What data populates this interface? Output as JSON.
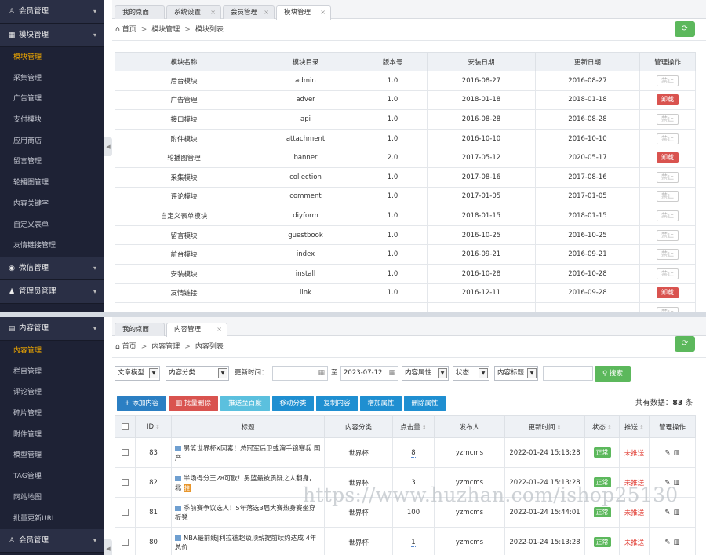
{
  "top": {
    "sidebar": {
      "groups_top": [
        {
          "icon": "user-icon",
          "glyph": "♙",
          "label": "会员管理"
        },
        {
          "icon": "module-icon",
          "glyph": "▦",
          "label": "模块管理"
        }
      ],
      "items": [
        "模块管理",
        "采集管理",
        "广告管理",
        "支付模块",
        "应用商店",
        "留言管理",
        "轮播图管理",
        "内容关键字",
        "自定义表单",
        "友情链接管理"
      ],
      "active_index": 0,
      "groups_bottom": [
        {
          "icon": "wechat-icon",
          "glyph": "◉",
          "label": "微信管理"
        },
        {
          "icon": "admin-user-icon",
          "glyph": "♟",
          "label": "管理员管理"
        }
      ]
    },
    "tabs": [
      "我的桌面",
      "系统设置",
      "会员管理",
      "模块管理"
    ],
    "active_tab": 3,
    "breadcrumb": [
      "首页",
      "模块管理",
      "模块列表"
    ],
    "table": {
      "headers": [
        "模块名称",
        "模块目录",
        "版本号",
        "安装日期",
        "更新日期",
        "管理操作"
      ],
      "disable_label": "禁止",
      "uninstall_label": "卸载",
      "rows": [
        {
          "name": "后台模块",
          "dir": "admin",
          "version": "1.0",
          "install": "2016-08-27",
          "update": "2016-08-27",
          "action": "disable"
        },
        {
          "name": "广告管理",
          "dir": "adver",
          "version": "1.0",
          "install": "2018-01-18",
          "update": "2018-01-18",
          "action": "uninstall"
        },
        {
          "name": "接口模块",
          "dir": "api",
          "version": "1.0",
          "install": "2016-08-28",
          "update": "2016-08-28",
          "action": "disable"
        },
        {
          "name": "附件模块",
          "dir": "attachment",
          "version": "1.0",
          "install": "2016-10-10",
          "update": "2016-10-10",
          "action": "disable"
        },
        {
          "name": "轮播图管理",
          "dir": "banner",
          "version": "2.0",
          "install": "2017-05-12",
          "update": "2020-05-17",
          "action": "uninstall"
        },
        {
          "name": "采集模块",
          "dir": "collection",
          "version": "1.0",
          "install": "2017-08-16",
          "update": "2017-08-16",
          "action": "disable"
        },
        {
          "name": "评论模块",
          "dir": "comment",
          "version": "1.0",
          "install": "2017-01-05",
          "update": "2017-01-05",
          "action": "disable"
        },
        {
          "name": "自定义表单模块",
          "dir": "diyform",
          "version": "1.0",
          "install": "2018-01-15",
          "update": "2018-01-15",
          "action": "disable"
        },
        {
          "name": "留言模块",
          "dir": "guestbook",
          "version": "1.0",
          "install": "2016-10-25",
          "update": "2016-10-25",
          "action": "disable"
        },
        {
          "name": "前台模块",
          "dir": "index",
          "version": "1.0",
          "install": "2016-09-21",
          "update": "2016-09-21",
          "action": "disable"
        },
        {
          "name": "安装模块",
          "dir": "install",
          "version": "1.0",
          "install": "2016-10-28",
          "update": "2016-10-28",
          "action": "disable"
        },
        {
          "name": "友情链接",
          "dir": "link",
          "version": "1.0",
          "install": "2016-12-11",
          "update": "2016-09-28",
          "action": "uninstall"
        },
        {
          "name": "",
          "dir": "",
          "version": "",
          "install": "",
          "update": "",
          "action": "disable"
        }
      ]
    }
  },
  "bottom": {
    "sidebar": {
      "groups_top": [
        {
          "icon": "content-icon",
          "glyph": "▤",
          "label": "内容管理"
        }
      ],
      "items": [
        "内容管理",
        "栏目管理",
        "评论管理",
        "碎片管理",
        "附件管理",
        "模型管理",
        "TAG管理",
        "网站地图",
        "批量更新URL"
      ],
      "active_index": 0,
      "groups_bottom": [
        {
          "icon": "user-icon",
          "glyph": "♙",
          "label": "会员管理"
        }
      ]
    },
    "tabs": [
      "我的桌面",
      "内容管理"
    ],
    "active_tab": 1,
    "breadcrumb": [
      "首页",
      "内容管理",
      "内容列表"
    ],
    "filters": {
      "model": "文章模型",
      "category": "内容分类",
      "time_label": "更新时间：",
      "date_start": "",
      "to_label": "至",
      "date_end": "2023-07-12",
      "attr": "内容属性",
      "status": "状态",
      "title_field": "内容标题",
      "keyword": "",
      "search_label": "搜索"
    },
    "actions": [
      {
        "label": "添加内容",
        "color": "#2b7fc3",
        "icon": "plus-icon",
        "glyph": "+"
      },
      {
        "label": "批量删除",
        "color": "#d9534f",
        "icon": "trash-icon",
        "glyph": "▥"
      },
      {
        "label": "推送至百度",
        "color": "#5bc0de"
      },
      {
        "label": "移动分类",
        "color": "#1f8fd1"
      },
      {
        "label": "复制内容",
        "color": "#1f8fd1"
      },
      {
        "label": "增加属性",
        "color": "#1f8fd1"
      },
      {
        "label": "删除属性",
        "color": "#1f8fd1"
      }
    ],
    "total_label": "共有数据：",
    "total": "83",
    "total_unit": "条",
    "table": {
      "headers": [
        "",
        "ID",
        "标题",
        "内容分类",
        "点击量",
        "发布人",
        "更新时间",
        "状态",
        "推送",
        "管理操作"
      ],
      "rows": [
        {
          "id": "83",
          "title": "男篮世界杯X因素！总冠军后卫或演手锦赛兵 国产",
          "tag": "",
          "category": "世界杯",
          "clicks": "8",
          "author": "yzmcms",
          "updated": "2022-01-24 15:13:28",
          "status": "正常",
          "push": "未推送"
        },
        {
          "id": "82",
          "title": "半场得分王28可欧！男篮最被质疑之人翻身，北",
          "tag": "推",
          "category": "世界杯",
          "clicks": "3",
          "author": "yzmcms",
          "updated": "2022-01-24 15:13:28",
          "status": "正常",
          "push": "未推送"
        },
        {
          "id": "81",
          "title": "季前赛争议选人！5年落选3届大赛热身赛坐穿板凳",
          "tag": "",
          "category": "世界杯",
          "clicks": "100",
          "author": "yzmcms",
          "updated": "2022-01-24 15:44:01",
          "status": "正常",
          "push": "未推送"
        },
        {
          "id": "80",
          "title": "NBA最前线|利拉德超级顶薪提前续约达成 4年总价",
          "tag": "",
          "category": "世界杯",
          "clicks": "1",
          "author": "yzmcms",
          "updated": "2022-01-24 15:13:28",
          "status": "正常",
          "push": "未推送"
        }
      ]
    }
  },
  "watermark": "https://www.huzhan.com/ishop25130"
}
